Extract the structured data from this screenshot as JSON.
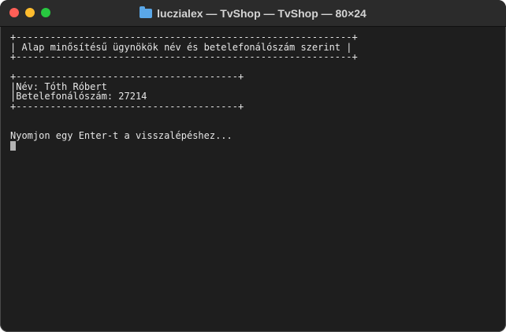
{
  "window": {
    "title": "luczialex — TvShop — TvShop — 80×24",
    "icons": {
      "close": "close-light",
      "minimize": "minimize-light",
      "zoom": "zoom-light",
      "folder": "folder-icon"
    }
  },
  "terminal": {
    "lines": [
      "+-----------------------------------------------------------+",
      "| Alap minősítésű ügynökök név és betelefonálószám szerint |",
      "+-----------------------------------------------------------+",
      "",
      "+---------------------------------------+",
      "|Név: Tóth Róbert",
      "|Betelefonálószám: 27214",
      "+---------------------------------------+",
      "",
      "",
      "Nyomjon egy Enter-t a visszalépéshez..."
    ]
  }
}
